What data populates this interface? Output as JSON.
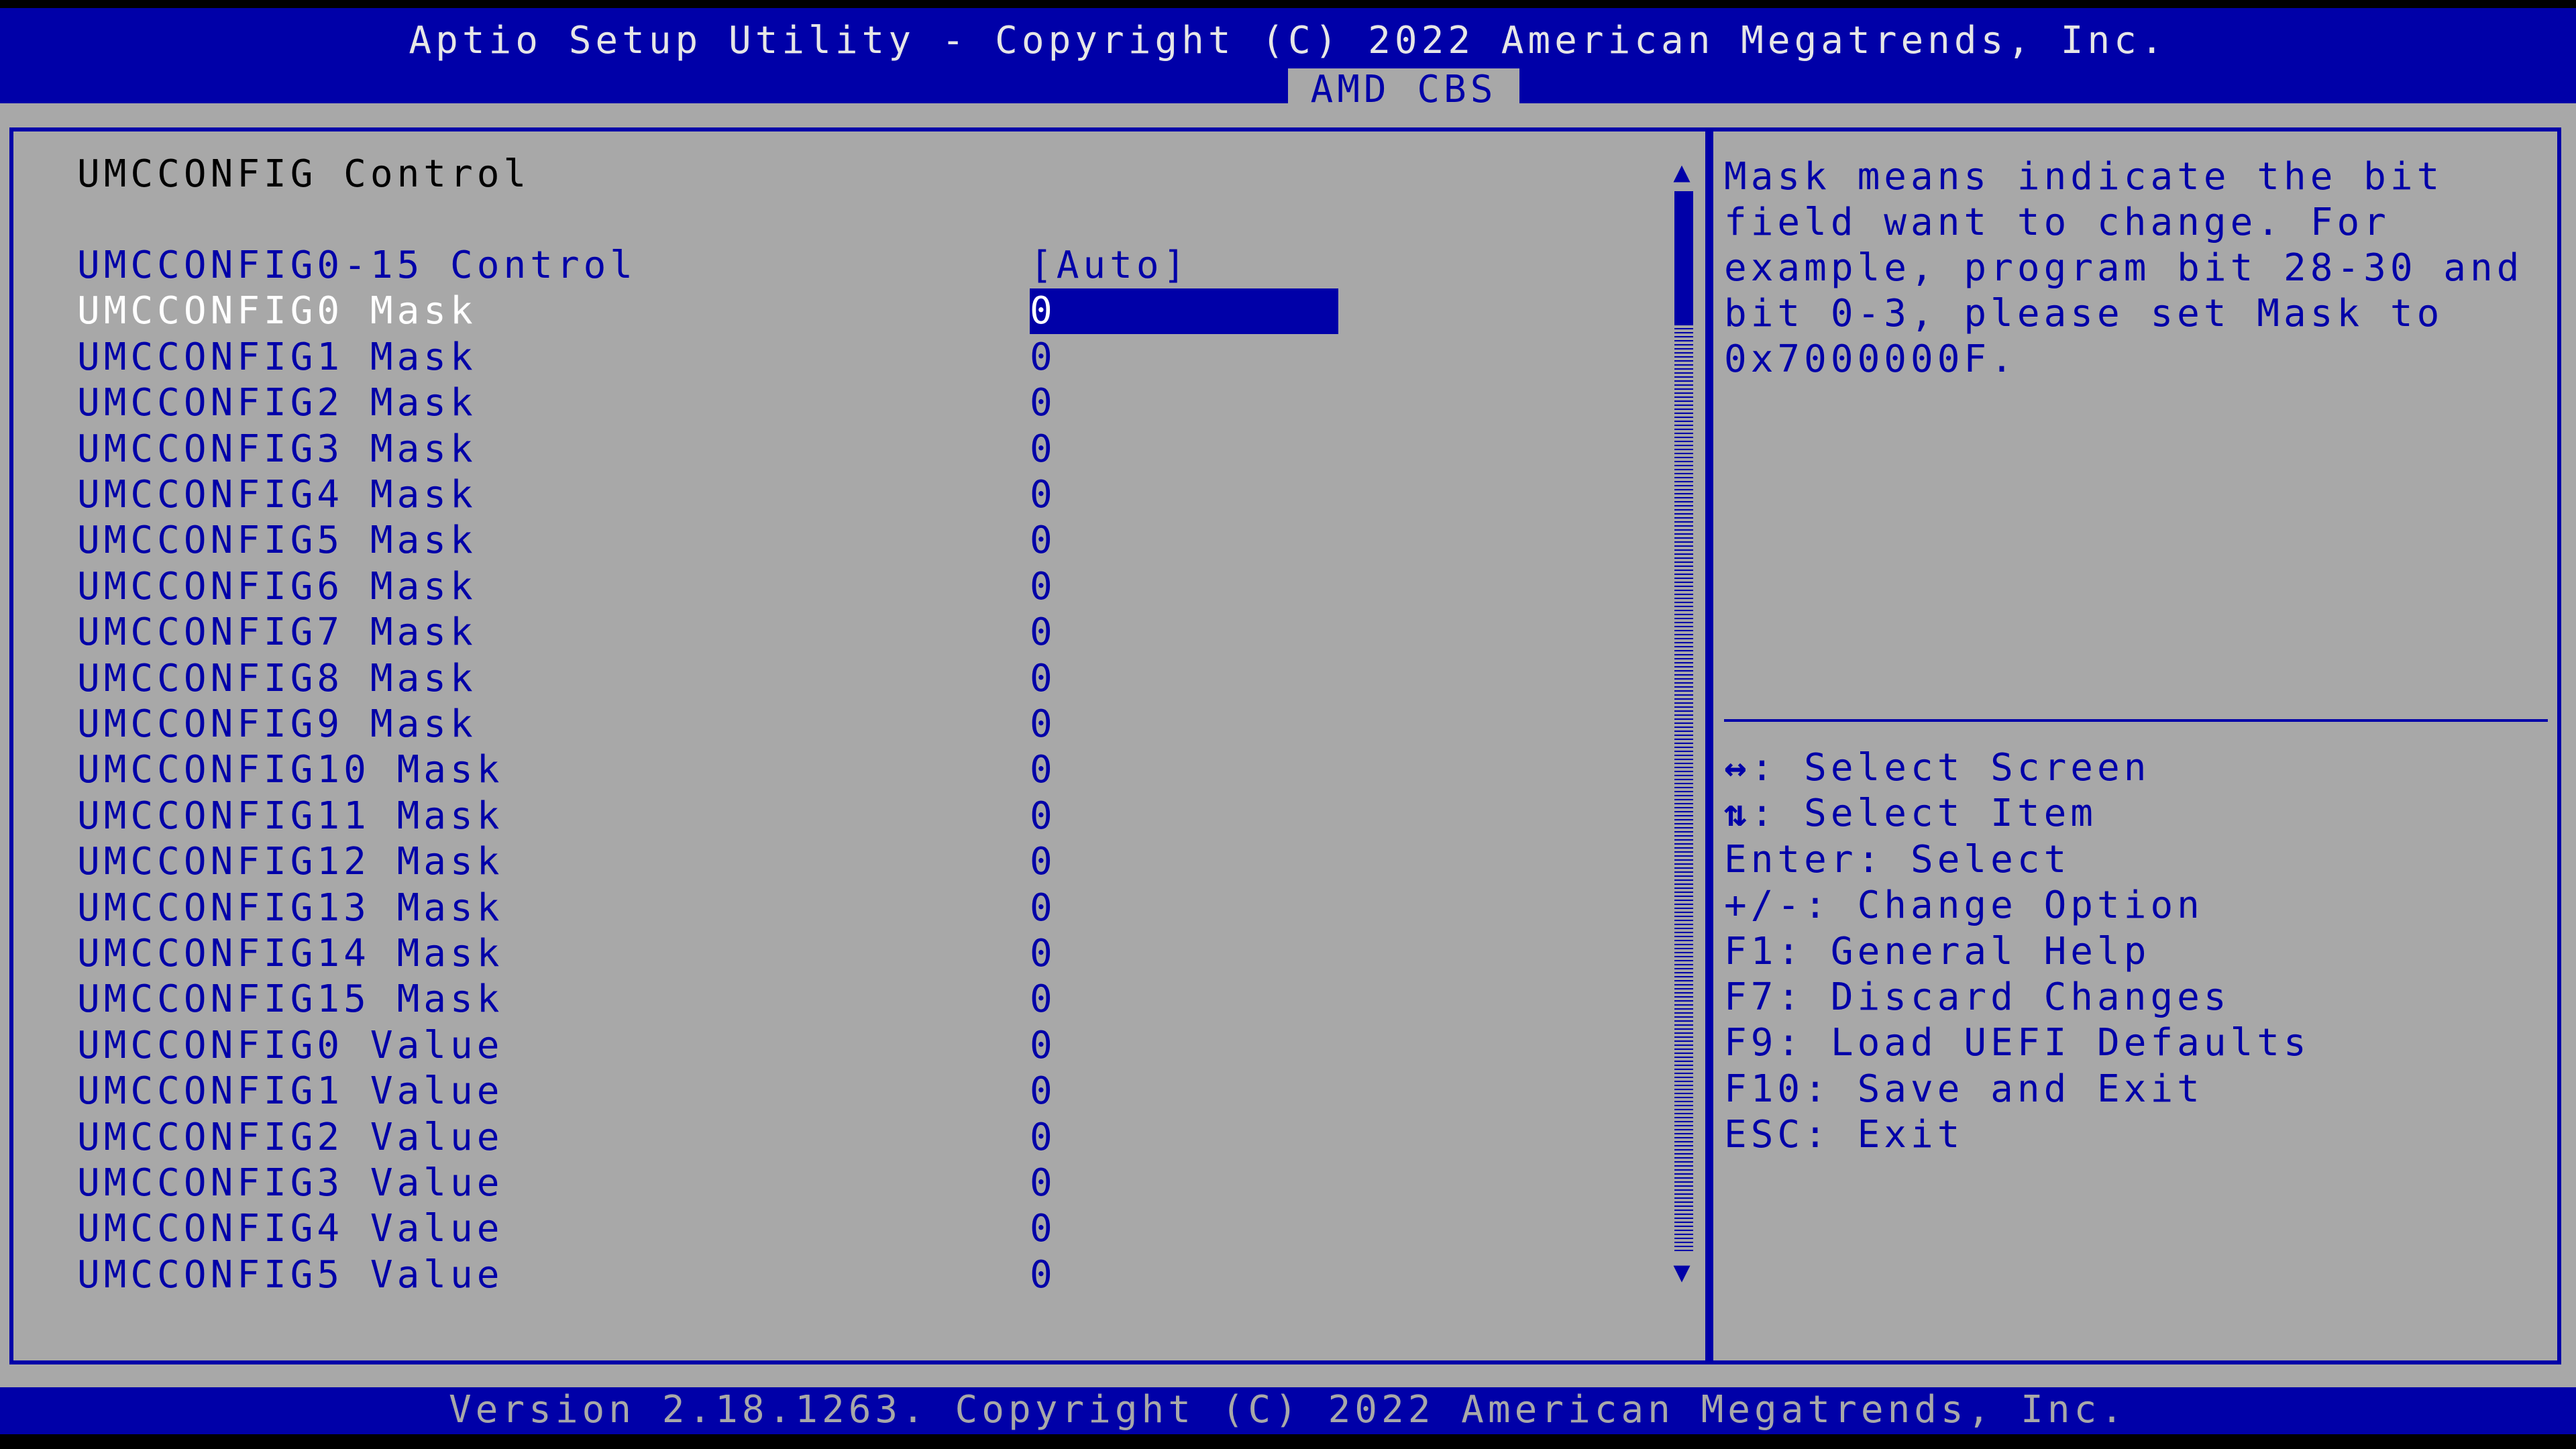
{
  "header": {
    "title": "Aptio Setup Utility - Copyright (C) 2022 American Megatrends, Inc.",
    "active_tab": "AMD CBS"
  },
  "section": {
    "title": "UMCCONFIG Control"
  },
  "menu_items": [
    {
      "label": "UMCCONFIG0-15 Control",
      "value": "[Auto]"
    },
    {
      "label": "UMCCONFIG0 Mask",
      "value": "0"
    },
    {
      "label": "UMCCONFIG1 Mask",
      "value": "0"
    },
    {
      "label": "UMCCONFIG2 Mask",
      "value": "0"
    },
    {
      "label": "UMCCONFIG3 Mask",
      "value": "0"
    },
    {
      "label": "UMCCONFIG4 Mask",
      "value": "0"
    },
    {
      "label": "UMCCONFIG5 Mask",
      "value": "0"
    },
    {
      "label": "UMCCONFIG6 Mask",
      "value": "0"
    },
    {
      "label": "UMCCONFIG7 Mask",
      "value": "0"
    },
    {
      "label": "UMCCONFIG8 Mask",
      "value": "0"
    },
    {
      "label": "UMCCONFIG9 Mask",
      "value": "0"
    },
    {
      "label": "UMCCONFIG10 Mask",
      "value": "0"
    },
    {
      "label": "UMCCONFIG11 Mask",
      "value": "0"
    },
    {
      "label": "UMCCONFIG12 Mask",
      "value": "0"
    },
    {
      "label": "UMCCONFIG13 Mask",
      "value": "0"
    },
    {
      "label": "UMCCONFIG14 Mask",
      "value": "0"
    },
    {
      "label": "UMCCONFIG15 Mask",
      "value": "0"
    },
    {
      "label": "UMCCONFIG0 Value",
      "value": "0"
    },
    {
      "label": "UMCCONFIG1 Value",
      "value": "0"
    },
    {
      "label": "UMCCONFIG2 Value",
      "value": "0"
    },
    {
      "label": "UMCCONFIG3 Value",
      "value": "0"
    },
    {
      "label": "UMCCONFIG4 Value",
      "value": "0"
    },
    {
      "label": "UMCCONFIG5 Value",
      "value": "0"
    }
  ],
  "selected_index": 1,
  "help": {
    "text": "Mask means indicate the bit\nfield want to change. For\nexample, program bit 28-30 and\nbit 0-3, please set Mask to\n0x7000000F."
  },
  "keys": [
    {
      "glyph": "↔",
      "text": ": Select Screen"
    },
    {
      "glyph": "⇅",
      "text": ": Select Item"
    },
    {
      "glyph": "",
      "text": "Enter: Select"
    },
    {
      "glyph": "",
      "text": "+/-: Change Option"
    },
    {
      "glyph": "",
      "text": "F1: General Help"
    },
    {
      "glyph": "",
      "text": "F7: Discard Changes"
    },
    {
      "glyph": "",
      "text": "F9: Load UEFI Defaults"
    },
    {
      "glyph": "",
      "text": "F10: Save and Exit"
    },
    {
      "glyph": "",
      "text": "ESC: Exit"
    }
  ],
  "scrollbar": {
    "up_glyph": "▲",
    "down_glyph": "▼",
    "position": 0.0
  },
  "footer": {
    "text": "Version 2.18.1263. Copyright (C) 2022 American Megatrends, Inc."
  },
  "colors": {
    "bios_blue": "#0000a8",
    "bios_gray": "#a8a8a8",
    "text_white": "#ffffff"
  }
}
